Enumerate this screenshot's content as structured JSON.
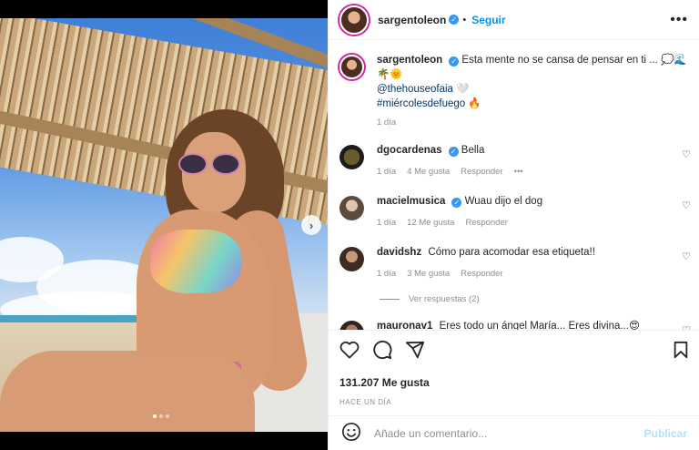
{
  "header": {
    "username": "sargentoleon",
    "follow_label": "Seguir",
    "more_label": "•••"
  },
  "caption": {
    "username": "sargentoleon",
    "text_line1": "Esta mente no se cansa de pensar en ti ... 💭🌊",
    "text_line2": "🌴🌞",
    "mention": "@thehouseofaia 🤍",
    "hashtag": "#miércolesdefuego 🔥",
    "time": "1 día"
  },
  "comments": [
    {
      "username": "dgocardenas",
      "verified": true,
      "text": "Bella",
      "time": "1 día",
      "likes": "4 Me gusta",
      "reply": "Responder",
      "more": "•••"
    },
    {
      "username": "macielmusica",
      "verified": true,
      "text": "Wuau dijo el dog",
      "time": "1 día",
      "likes": "12 Me gusta",
      "reply": "Responder"
    },
    {
      "username": "davidshz",
      "verified": false,
      "text": "Cómo para acomodar esa etiqueta!!",
      "time": "1 día",
      "likes": "3 Me gusta",
      "reply": "Responder",
      "replies_label": "Ver respuestas (2)"
    },
    {
      "username": "mauronav1",
      "verified": false,
      "text": "Eres todo un ángel María... Eres divina...😍"
    }
  ],
  "actions": {
    "likes_count": "131.207 Me gusta",
    "time_ago": "HACE UN DÍA"
  },
  "add_comment": {
    "placeholder": "Añade un comentario...",
    "publish_label": "Publicar"
  },
  "carousel": {
    "total": 3,
    "current": 1
  },
  "colors": {
    "accent": "#0095f6",
    "verified": "#3897f0",
    "publish_disabled": "#b2dffc"
  }
}
